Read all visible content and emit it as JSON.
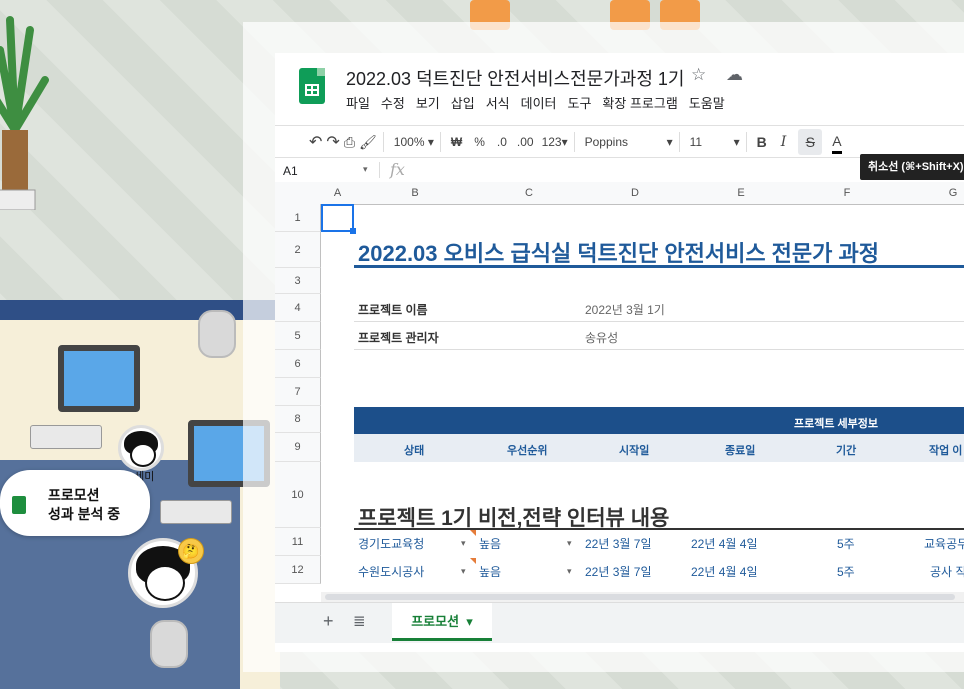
{
  "background": {
    "bubble_line1": "프로모션",
    "bubble_line2": "성과 분석 중",
    "avatar_name": "스세미",
    "emoji": "🤔"
  },
  "doc": {
    "title": "2022.03 덕트진단 안전서비스전문가과정 1기",
    "menu": [
      "파일",
      "수정",
      "보기",
      "삽입",
      "서식",
      "데이터",
      "도구",
      "확장 프로그램",
      "도움말"
    ]
  },
  "toolbar": {
    "zoom": "100%",
    "currency": "₩",
    "percent": "%",
    "dec_decrease": ".0",
    "dec_increase": ".00",
    "format_more": "123",
    "font": "Poppins",
    "size": "11",
    "bold": "B",
    "italic": "I",
    "strike": "S",
    "text_color": "A",
    "tooltip": "취소선 (⌘+Shift+X)"
  },
  "formula": {
    "cell_ref": "A1",
    "fx": "fx"
  },
  "columns": [
    "A",
    "B",
    "C",
    "D",
    "E",
    "F",
    "G"
  ],
  "rows": [
    "1",
    "2",
    "3",
    "4",
    "5",
    "6",
    "7",
    "8",
    "9",
    "10",
    "11",
    "12"
  ],
  "sheet": {
    "main_title": "2022.03 오비스 급식실 덕트진단 안전서비스 전문가 과정",
    "project_name_label": "프로젝트 이름",
    "project_name_value": "2022년 3월 1기",
    "project_manager_label": "프로젝트 관리자",
    "project_manager_value": "송유성",
    "details_band": "프로젝트 세부정보",
    "headers": [
      "상태",
      "우선순위",
      "시작일",
      "종료일",
      "기간",
      "작업 이"
    ],
    "section_title": "프로젝트 1기 비전,전략 인터뷰 내용",
    "data_rows": [
      {
        "name": "경기도교육청",
        "priority": "높음",
        "start": "22년 3월 7일",
        "end": "22년 4월 4일",
        "duration": "5주",
        "task": "교육공두"
      },
      {
        "name": "수원도시공사",
        "priority": "높음",
        "start": "22년 3월 7일",
        "end": "22년 4월 4일",
        "duration": "5주",
        "task": "공사 직"
      }
    ]
  },
  "tabs": {
    "active": "프로모션"
  }
}
